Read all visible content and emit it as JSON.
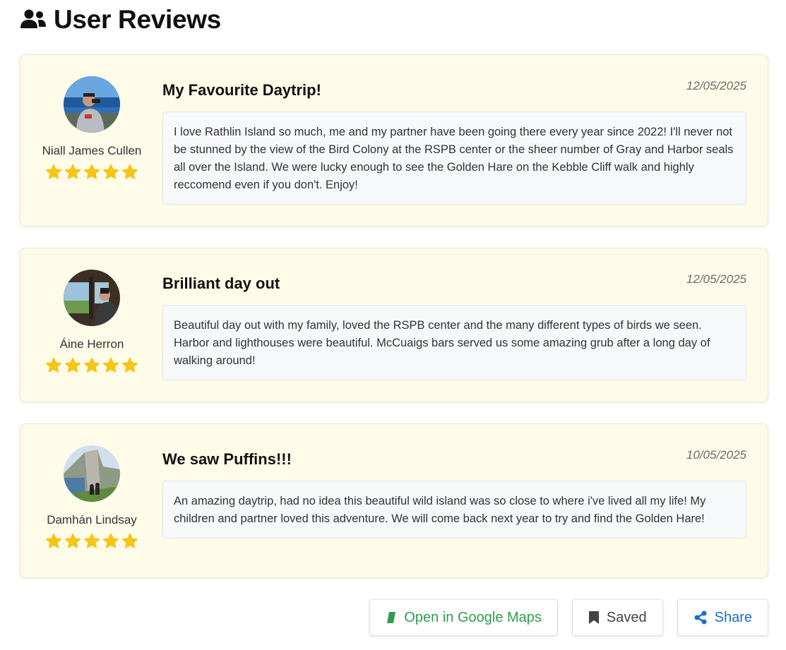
{
  "section": {
    "title": "User Reviews",
    "icon": "users-icon"
  },
  "reviews": [
    {
      "user": "Niall James Cullen",
      "rating": 5,
      "title": "My Favourite Daytrip!",
      "date": "12/05/2025",
      "body": "I love Rathlin Island so much, me and my partner have been going there every year since 2022! I'll never not be stunned by the view of the Bird Colony at the RSPB center or the sheer number of Gray and Harbor seals all over the Island. We were lucky enough to see the Golden Hare on the Kebble Cliff walk and highly reccomend even if you don't. Enjoy!"
    },
    {
      "user": "Áine Herron",
      "rating": 5,
      "title": "Brilliant day out",
      "date": "12/05/2025",
      "body": "Beautiful day out with my family, loved the RSPB center and the many different types of birds we seen. Harbor and lighthouses were beautiful. McCuaigs bars served us some amazing grub after a long day of walking around!"
    },
    {
      "user": "Damhán Lindsay",
      "rating": 5,
      "title": "We saw Puffins!!!",
      "date": "10/05/2025",
      "body": "An amazing daytrip, had no idea this beautiful wild island was so close to where i've lived all my life! My children and partner loved this adventure. We will come back next year to try and find the Golden Hare!"
    }
  ],
  "actions": {
    "maps_label": "Open in Google Maps",
    "saved_label": "Saved",
    "share_label": "Share"
  },
  "colors": {
    "star": "#f5c518",
    "card_bg": "#fefbe8",
    "maps": "#2e9e4e",
    "share": "#1a6fc4"
  }
}
